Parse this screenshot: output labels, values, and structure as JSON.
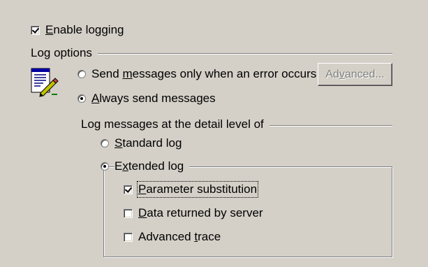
{
  "enable_logging": {
    "pre": "",
    "accel": "E",
    "post": "nable logging",
    "checked": true
  },
  "log_options": {
    "heading": "Log options",
    "radio_error_only": {
      "pre": "Send ",
      "accel": "m",
      "post": "essages only when an error occurs",
      "selected": false
    },
    "radio_always": {
      "pre": "",
      "accel": "A",
      "post": "lways send messages",
      "selected": true
    },
    "advanced_button": {
      "pre": "Ad",
      "accel": "v",
      "post": "anced...",
      "enabled": false
    },
    "icon": "log-document-icon"
  },
  "detail_level": {
    "heading": "Log messages at the detail level of",
    "radio_standard": {
      "pre": "",
      "accel": "S",
      "post": "tandard log",
      "selected": false
    },
    "radio_extended": {
      "pre": "E",
      "accel": "x",
      "post": "tended log",
      "selected": true
    }
  },
  "extended_options": {
    "parameter_substitution": {
      "pre": "",
      "accel": "P",
      "post": "arameter substitution",
      "checked": true
    },
    "data_returned": {
      "pre": "",
      "accel": "D",
      "post": "ata returned by server",
      "checked": false
    },
    "advanced_trace": {
      "pre": "Advanced ",
      "accel": "t",
      "post": "race",
      "checked": false
    }
  }
}
